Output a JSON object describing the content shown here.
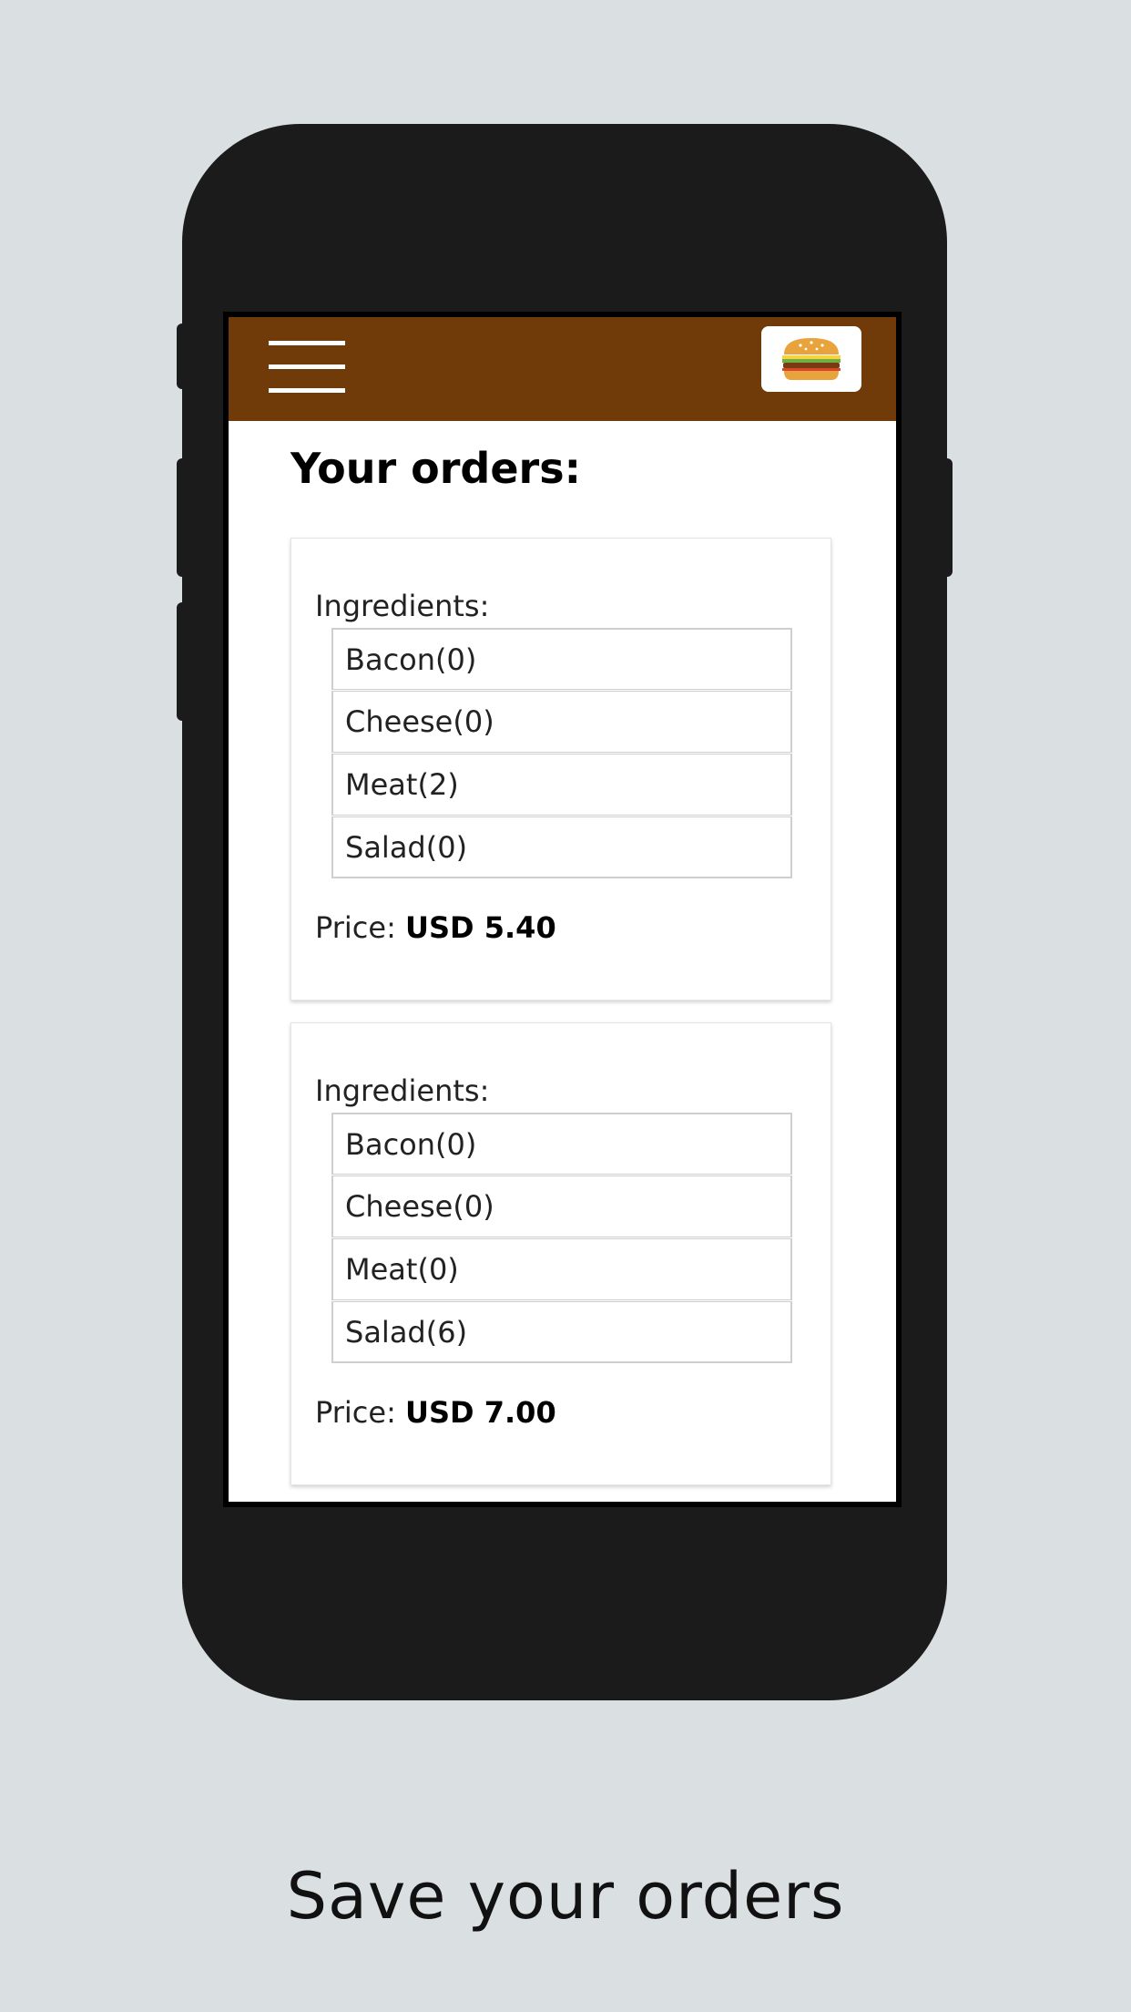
{
  "toolbar": {
    "menu_icon": "hamburger-menu-icon",
    "logo_icon": "burger-logo-icon",
    "colors": {
      "background": "#703b09",
      "logo_background": "#ffffff"
    }
  },
  "page": {
    "title": "Your orders:"
  },
  "orders": [
    {
      "ingredients_label": "Ingredients:",
      "ingredients": [
        "Bacon(0)",
        "Cheese(0)",
        "Meat(2)",
        "Salad(0)"
      ],
      "price_label": "Price: ",
      "price_value": "USD 5.40"
    },
    {
      "ingredients_label": "Ingredients:",
      "ingredients": [
        "Bacon(0)",
        "Cheese(0)",
        "Meat(0)",
        "Salad(6)"
      ],
      "price_label": "Price: ",
      "price_value": "USD 7.00"
    }
  ],
  "caption": "Save your orders",
  "colors": {
    "page_background": "#dadfe2",
    "device_body": "#1b1b1b"
  }
}
